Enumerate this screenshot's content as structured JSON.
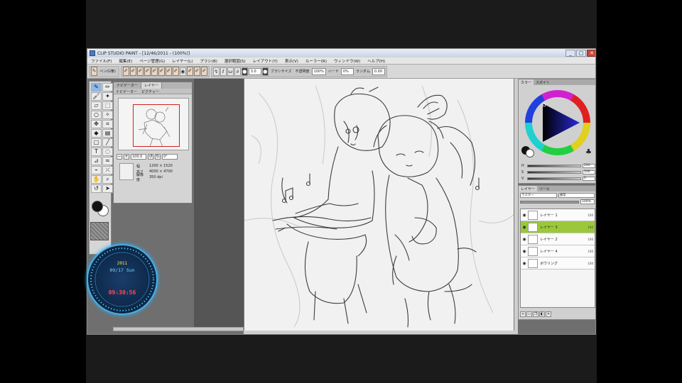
{
  "window": {
    "title": "CLIP STUDIO PAINT - [12/46/2011 - (100%)]",
    "buttons": [
      "_",
      "□",
      "✕"
    ]
  },
  "menu": [
    "ファイル(F)",
    "編集(E)",
    "ページ管理(G)",
    "レイヤー(L)",
    "ブラシ(B)",
    "選択範囲(S)",
    "レイアウト(Y)",
    "表示(V)",
    "ルーラー(R)",
    "ウィンドウ(W)",
    "ヘルプ(H)"
  ],
  "toolbar": {
    "tool_name": "ペン(G筆)",
    "brush_size_label": "ブラシサイズ",
    "brush_size_value": "3.0",
    "opacity_label": "不透明度",
    "opacity_value": "100%",
    "hardness_label": "ハード",
    "hardness_value": "0%",
    "density_label": "ランダム",
    "density_value": "0.00"
  },
  "navigator": {
    "tabs": [
      "ナビゲーター",
      "レイヤー"
    ],
    "subtabs": [
      "ナビゲーター",
      "ピクチャー"
    ],
    "zoom_value": "100.0",
    "angle_value": "0°",
    "info": [
      {
        "k": "幅",
        "v": "1200 × 1520"
      },
      {
        "k": "高さ",
        "v": "4000 × 4700"
      },
      {
        "k": "解像度",
        "v": "350 dpi"
      }
    ]
  },
  "color_panel": {
    "tabs": [
      "カラー",
      "スポイト"
    ],
    "sliders": [
      {
        "label": "H",
        "value": "240"
      },
      {
        "label": "S",
        "value": "100"
      },
      {
        "label": "V",
        "value": "0"
      }
    ]
  },
  "layer_panel": {
    "tabs": [
      "レイヤー",
      "ツール"
    ],
    "blend_mode": "通常",
    "mode_select": "ラスター",
    "opacity_value": "100%",
    "layers": [
      {
        "name": "レイヤー 1",
        "opacity": "100",
        "selected": false
      },
      {
        "name": "レイヤー 3",
        "opacity": "100",
        "selected": true
      },
      {
        "name": "レイヤー 2",
        "opacity": "100",
        "selected": false
      },
      {
        "name": "レイヤー 4",
        "opacity": "100",
        "selected": false
      },
      {
        "name": "ボウリング",
        "opacity": "100",
        "selected": false
      }
    ]
  },
  "clock": {
    "line1": "2011",
    "line2": "09/17 Sun",
    "line3": "09:30:56"
  }
}
